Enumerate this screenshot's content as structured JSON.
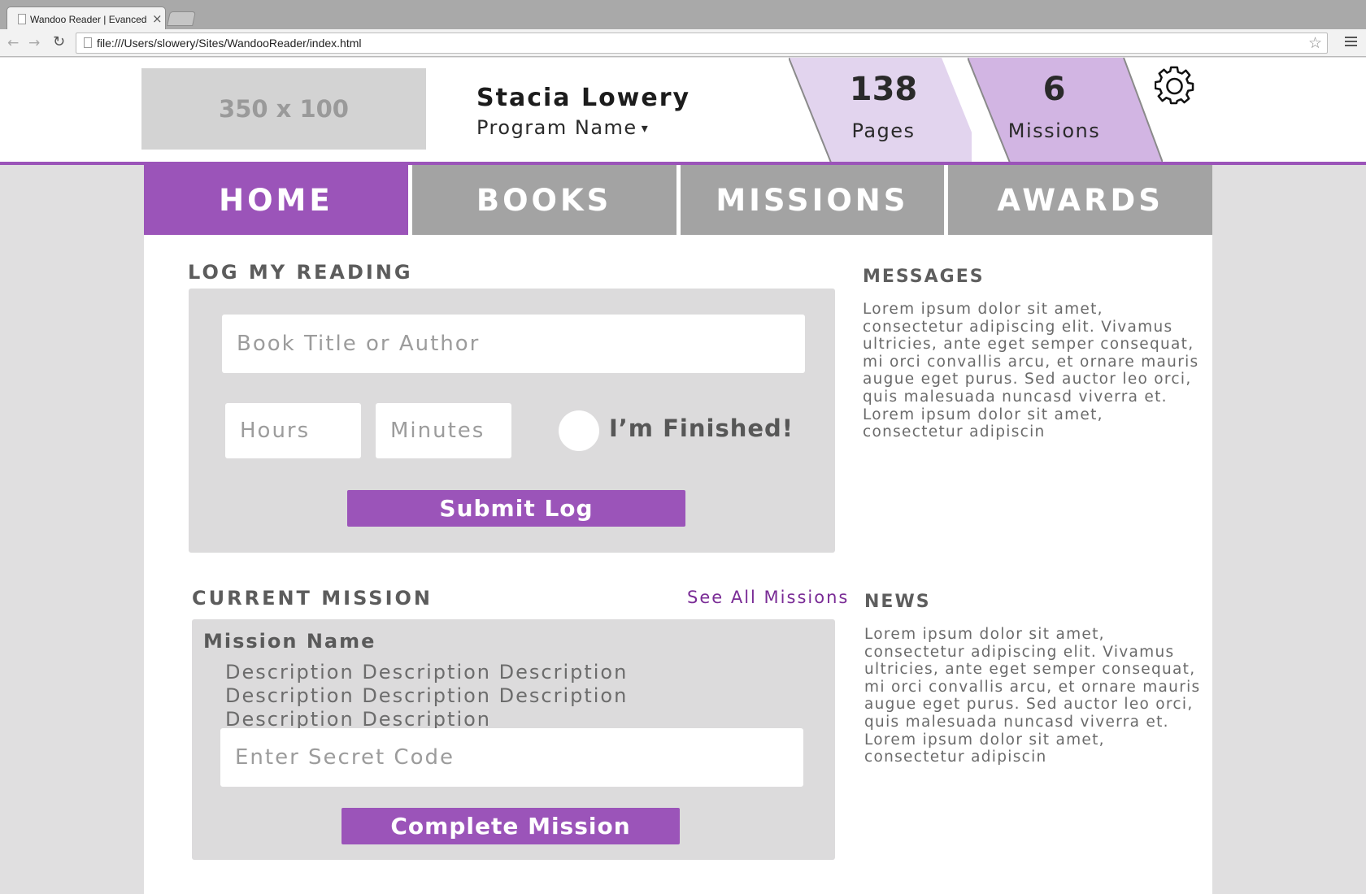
{
  "browser": {
    "tab_title": "Wandoo Reader | Evanced",
    "tab_close": "×",
    "url": "file:///Users/slowery/Sites/WandooReader/index.html",
    "back_icon": "arrow-left-icon",
    "forward_icon": "arrow-right-icon",
    "reload_icon": "reload-icon",
    "bookmark_icon": "star-icon",
    "menu_icon": "hamburger-icon"
  },
  "header": {
    "logo_placeholder": "350 x 100",
    "user_name": "Stacia Lowery",
    "program_label": "Program Name",
    "program_caret": "▾",
    "stats": {
      "pages": {
        "value": "138",
        "label": "Pages",
        "color": "#e2d4ee"
      },
      "missions": {
        "value": "6",
        "label": "Missions",
        "color": "#d2b5e3"
      }
    },
    "settings_icon": "gear-icon",
    "accent_color": "#9b54b9"
  },
  "nav": {
    "tabs": [
      {
        "label": "HOME",
        "active": true
      },
      {
        "label": "BOOKS",
        "active": false
      },
      {
        "label": "MISSIONS",
        "active": false
      },
      {
        "label": "AWARDS",
        "active": false
      }
    ]
  },
  "log_reading": {
    "title": "LOG MY READING",
    "book_placeholder": "Book Title or Author",
    "hours_placeholder": "Hours",
    "minutes_placeholder": "Minutes",
    "finished_label": "I’m Finished!",
    "submit_label": "Submit Log"
  },
  "current_mission": {
    "title": "CURRENT MISSION",
    "see_all_link": "See All Missions",
    "mission_name": "Mission Name",
    "description": "Description Description Description Description Description Description Description Description",
    "code_placeholder": "Enter Secret Code",
    "complete_label": "Complete Mission"
  },
  "messages": {
    "title": "MESSAGES",
    "body": "Lorem ipsum dolor sit amet, consectetur adipiscing elit. Vivamus ultricies, ante eget semper consequat, mi orci convallis arcu, et ornare mauris augue eget purus. Sed auctor leo orci, quis malesuada nuncasd  viverra et. Lorem ipsum dolor sit amet, consectetur adipiscin"
  },
  "news": {
    "title": "NEWS",
    "body": "Lorem ipsum dolor sit amet, consectetur adipiscing elit. Vivamus ultricies, ante eget semper consequat, mi orci convallis arcu, et ornare mauris augue eget purus. Sed auctor leo orci, quis malesuada nuncasd  viverra et. Lorem ipsum dolor sit amet, consectetur adipiscin"
  }
}
